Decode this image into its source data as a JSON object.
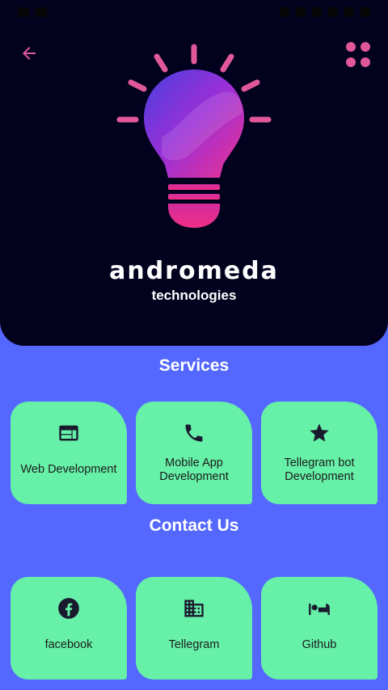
{
  "brand": {
    "name": "andromeda",
    "subtitle": "technologies"
  },
  "colors": {
    "hero_bg": "#02021f",
    "page_bg": "#5468ff",
    "card_bg": "#66f0a8",
    "accent_pink": "#e0589a",
    "icon_dark": "#1a1a2e"
  },
  "services": {
    "title": "Services",
    "items": [
      {
        "label": "Web Development",
        "icon": "web-window-icon"
      },
      {
        "label": "Mobile App Development",
        "icon": "phone-icon"
      },
      {
        "label": "Tellegram bot Development",
        "icon": "star-icon"
      }
    ]
  },
  "contact": {
    "title": "Contact Us",
    "items": [
      {
        "label": "facebook",
        "icon": "facebook-icon"
      },
      {
        "label": "Tellegram",
        "icon": "building-icon"
      },
      {
        "label": "Github",
        "icon": "bed-icon"
      }
    ]
  }
}
